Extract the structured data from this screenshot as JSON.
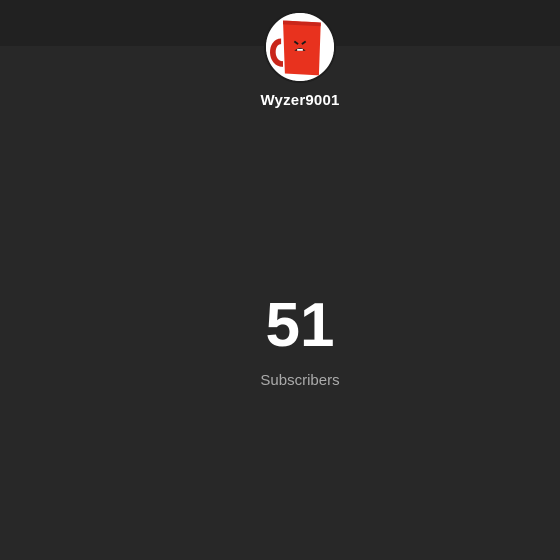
{
  "channel": {
    "name": "Wyzer9001",
    "avatar_icon": "red-mug-character-avatar"
  },
  "stats": {
    "subscriber_count": "51",
    "subscriber_label": "Subscribers"
  },
  "colors": {
    "background": "#282828",
    "top_bar": "#212121",
    "text_primary": "#ffffff",
    "text_secondary": "#aaaaaa",
    "avatar_accent": "#e8321e"
  }
}
